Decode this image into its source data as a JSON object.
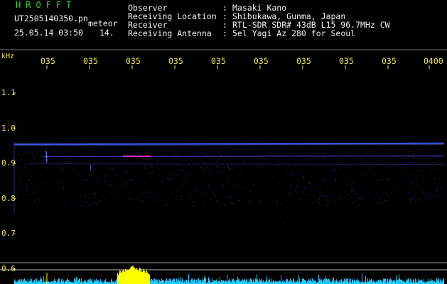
{
  "header": {
    "logo": "HROFFT",
    "filename": "UT2505140350.pn",
    "meteor_label": "meteor",
    "timestamp": "25.05.14 03:50",
    "timestamp_tail": "14.",
    "rows": [
      {
        "label": "Observer",
        "value": "Masaki Kano"
      },
      {
        "label": "Receiving Location",
        "value": "Shibukawa, Gunma, Japan"
      },
      {
        "label": "Receiver",
        "value": "RTL-SDR SDR# 43dB L15 96.7MHz CW"
      },
      {
        "label": "Receiving Antenna",
        "value": "5el Yagi Az 280 for Seoul"
      }
    ],
    "colon": ":"
  },
  "axes": {
    "y_unit": "kHz",
    "x_ticks": [
      "035",
      "035",
      "035",
      "035",
      "035",
      "035",
      "035",
      "035",
      "035",
      "0400"
    ],
    "y_ticks": [
      "1.1",
      "1.0",
      "0.9",
      "0.8",
      "0.7",
      "0.6"
    ]
  },
  "chart_data": {
    "type": "heatmap",
    "ylabel": "kHz",
    "ylim": [
      0.58,
      1.15
    ],
    "x_tick_labels": [
      "035",
      "035",
      "035",
      "035",
      "035",
      "035",
      "035",
      "035",
      "035",
      "0400"
    ],
    "y_tick_labels": [
      "1.1",
      "1.0",
      "0.9",
      "0.8",
      "0.7",
      "0.6"
    ],
    "carrier_freq_khz": 0.955,
    "secondary_line_khz": 0.92,
    "colors": {
      "label": "#29d829",
      "text": "#f2f2f2",
      "tick": "#f0e850",
      "carrier": "#3a5cff",
      "meteor": "#ff2bd6",
      "spectrum": "#1ec8ff",
      "spectrum_peak": "#ffff00"
    }
  }
}
